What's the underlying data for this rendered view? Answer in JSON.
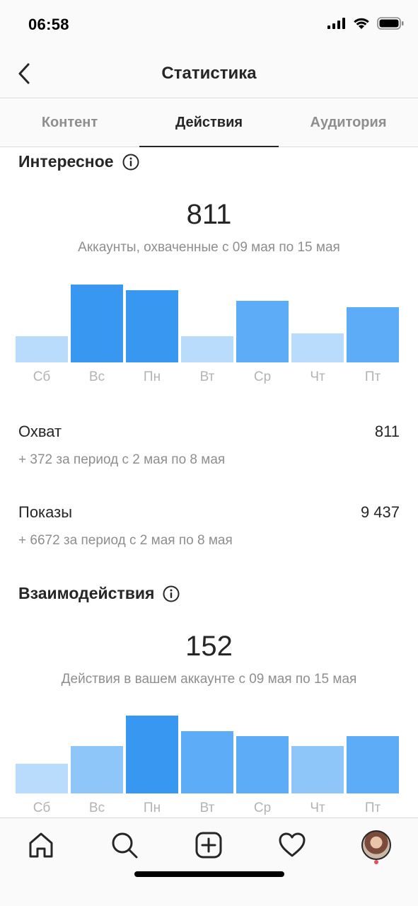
{
  "status_bar": {
    "time": "06:58"
  },
  "header": {
    "title": "Статистика",
    "back_icon": "chevron-left-icon"
  },
  "tabs": [
    {
      "label": "Контент",
      "active": false
    },
    {
      "label": "Действия",
      "active": true
    },
    {
      "label": "Аудитория",
      "active": false
    }
  ],
  "discovery": {
    "title": "Интересное",
    "total": "811",
    "caption": "Аккаунты, охваченные с 09 мая по 15 мая",
    "stats": [
      {
        "label": "Охват",
        "value": "811",
        "delta": "+ 372 за период с 2 мая по 8 мая"
      },
      {
        "label": "Показы",
        "value": "9 437",
        "delta": "+ 6672 за период с 2 мая по 8 мая"
      }
    ]
  },
  "interactions": {
    "title": "Взаимодействия",
    "total": "152",
    "caption": "Действия в вашем аккаунте с 09 мая по 15 мая"
  },
  "colors": {
    "bar_light": "#b9dcfc",
    "bar_mid": "#8fc6fa",
    "bar_medium": "#5cacf7",
    "bar_strong": "#3897f0"
  },
  "bottom_nav": [
    "home-icon",
    "search-icon",
    "add-post-icon",
    "heart-icon",
    "profile-avatar"
  ],
  "chart_data": [
    {
      "type": "bar",
      "categories": [
        "Сб",
        "Вс",
        "Пн",
        "Вт",
        "Ср",
        "Чт",
        "Пт"
      ],
      "values": [
        34,
        100,
        93,
        34,
        79,
        37,
        71
      ],
      "shades": [
        "light",
        "strong",
        "strong",
        "light",
        "medium",
        "light",
        "medium"
      ]
    },
    {
      "type": "bar",
      "categories": [
        "Сб",
        "Вс",
        "Пн",
        "Вт",
        "Ср",
        "Чт",
        "Пт"
      ],
      "values": [
        38,
        61,
        100,
        80,
        74,
        61,
        74
      ],
      "shades": [
        "light",
        "mid",
        "strong",
        "medium",
        "medium",
        "mid",
        "medium"
      ]
    }
  ]
}
